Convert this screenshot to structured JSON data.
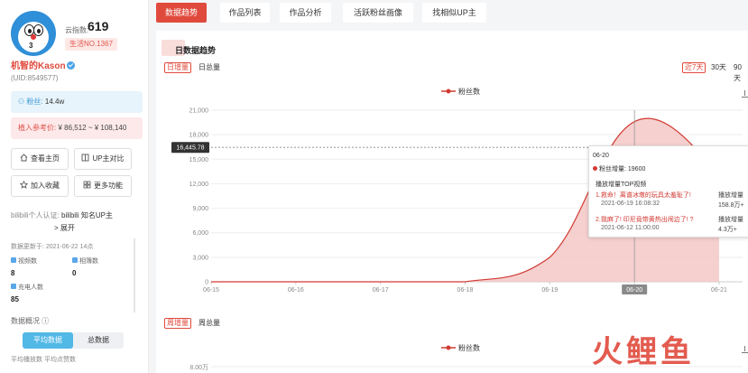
{
  "sidebar": {
    "fans_index_label": "云指数:",
    "fans_index_value": "619",
    "rank_badge": "生活NO.1367",
    "username": "机智的Kason",
    "uid": "(UID:8549577)",
    "fans_label": "粉丝:",
    "fans_value": "14.4w",
    "income_label": "植入参考价:",
    "income_value": "¥ 86,512 ~ ¥ 108,140",
    "buttons": {
      "homepage": "查看主页",
      "compare": "UP主对比",
      "favorite": "加入收藏",
      "more": "更多功能"
    },
    "cert_prefix": "bilibili个人认证:",
    "cert_value": "bilibili 知名UP主",
    "expand": "> 展开",
    "update_time": "数据更新于: 2021-06-22 14点",
    "stats": {
      "videos_label": "视频数",
      "videos_value": "8",
      "albums_label": "相簿数",
      "albums_value": "0",
      "charge_label": "充电人数",
      "charge_value": "85"
    },
    "overview_label": "数据概况 ⓘ",
    "overview_tabs": [
      "平均数据",
      "总数据"
    ],
    "overview_items": "平均播放数        平均点赞数"
  },
  "tabs": [
    "数据趋势",
    "作品列表",
    "作品分析",
    "活跃粉丝画像",
    "找相似UP主"
  ],
  "panel": {
    "title": "日数据趋势",
    "mode_tabs": [
      "日增量",
      "日总量"
    ],
    "range_tabs": [
      "近7天",
      "30天",
      "90天"
    ],
    "legend": "粉丝数",
    "mode_tabs_2": [
      "周增量",
      "周总量"
    ],
    "legend_2": "粉丝数",
    "chart2_first_tick": "8.00万"
  },
  "chart_data": {
    "type": "area",
    "x": [
      "06-15",
      "06-16",
      "06-17",
      "06-18",
      "06-19",
      "06-20",
      "06-21"
    ],
    "series": [
      {
        "name": "粉丝数",
        "values": [
          0,
          0,
          0,
          0,
          3000,
          19600,
          13500
        ],
        "color": "#d13a33"
      }
    ],
    "yticks": [
      "0",
      "3,000",
      "6,000",
      "9,000",
      "12,000",
      "15,000",
      "18,000",
      "21,000"
    ],
    "ylim": [
      0,
      21000
    ],
    "grid": true,
    "crosshair_value": "16,445.78",
    "highlight_x": "06-20"
  },
  "tooltip": {
    "date": "06-20",
    "fans": "粉丝增量: 19600",
    "section": "播放增量TOP视频",
    "items": [
      {
        "title": "1.救命！离谱冰墩的玩具太羞耻了!",
        "time": "2021-06-19 16:08:32",
        "metric_label": "播放增量",
        "metric_value": "158.8万+"
      },
      {
        "title": "2.我麻了! 印尼竟带黄热出闹边了! ?",
        "time": "2021-06-12 11:00:00",
        "metric_label": "播放增量",
        "metric_value": "4.3万+"
      }
    ]
  },
  "watermark": "火鲤鱼"
}
